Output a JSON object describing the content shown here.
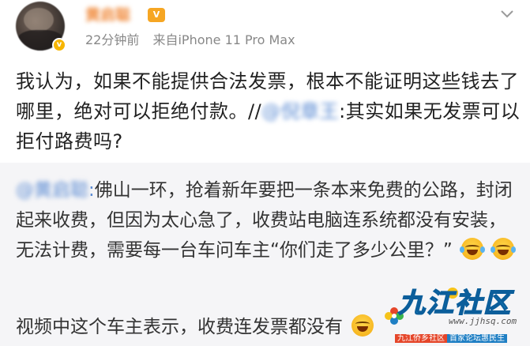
{
  "post": {
    "username": "黄启聪",
    "time": "22分钟前",
    "source": "来自iPhone 11 Pro Max",
    "text_before_mention": "我认为，如果不能提供合法发票，根本不能证明这些钱去了哪里，绝对可以拒绝付款。//",
    "mention": "@倪章王",
    "text_after_mention": ":其实如果无发票可以拒付路费吗?"
  },
  "repost": {
    "user": "@黄启聪",
    "separator": ":",
    "text": "佛山一环，抢着新年要把一条本来免费的公路，封闭起来收费，但因为太心急了，收费站电脑连系统都没有安装，无法计费，需要每一台车问车主“你们走了多少公里？”",
    "emoji_names": [
      "laugh-cry-emoji",
      "laugh-cry-emoji"
    ],
    "line2": "视频中这个车主表示，收费连发票都没有"
  },
  "watermark": {
    "logo": "九江社区",
    "url": "www.jjhsq.com",
    "tag_a": "九江侨乡社区",
    "tag_b": "首家论坛惠民生"
  },
  "colors": {
    "name_orange": "#f08a3c",
    "mention_blue": "#5b8bd3",
    "repost_bg": "#f5f5f7",
    "meta_gray": "#888888"
  }
}
